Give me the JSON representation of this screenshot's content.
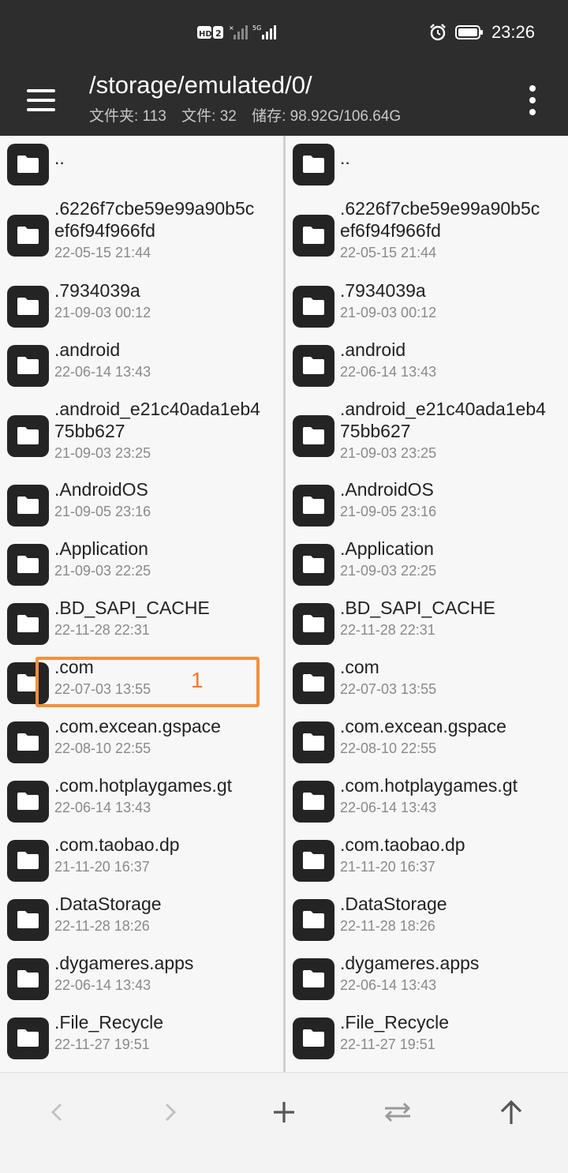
{
  "status_bar": {
    "network_badge": "HD 2",
    "network_5g": "5G",
    "time": "23:26",
    "icons": [
      "hd-icon",
      "signal-x-icon",
      "signal-5g-icon",
      "alarm-icon",
      "battery-icon"
    ]
  },
  "toolbar": {
    "path": "/storage/emulated/0/",
    "folders_label": "文件夹: 113",
    "files_label": "文件: 32",
    "storage_label": "储存: 98.92G/106.64G"
  },
  "annotation": {
    "label": "1"
  },
  "panes": {
    "left": {
      "items": [
        {
          "name": "..",
          "date": ""
        },
        {
          "name": ".6226f7cbe59e99a90b5c",
          "name2": "ef6f94f966fd",
          "date": "22-05-15 21:44"
        },
        {
          "name": ".7934039a",
          "date": "21-09-03 00:12"
        },
        {
          "name": ".android",
          "date": "22-06-14 13:43"
        },
        {
          "name": ".android_e21c40ada1eb4",
          "name2": "75bb627",
          "date": "21-09-03 23:25"
        },
        {
          "name": ".AndroidOS",
          "date": "21-09-05 23:16"
        },
        {
          "name": ".Application",
          "date": "21-09-03 22:25"
        },
        {
          "name": ".BD_SAPI_CACHE",
          "date": "22-11-28 22:31"
        },
        {
          "name": ".com",
          "date": "22-07-03 13:55"
        },
        {
          "name": ".com.excean.gspace",
          "date": "22-08-10 22:55"
        },
        {
          "name": ".com.hotplaygames.gt",
          "date": "22-06-14 13:43"
        },
        {
          "name": ".com.taobao.dp",
          "date": "21-11-20 16:37"
        },
        {
          "name": ".DataStorage",
          "date": "22-11-28 18:26"
        },
        {
          "name": ".dygameres.apps",
          "date": "22-06-14 13:43"
        },
        {
          "name": ".File_Recycle",
          "date": "22-11-27 19:51"
        }
      ]
    },
    "right": {
      "items": [
        {
          "name": "..",
          "date": ""
        },
        {
          "name": ".6226f7cbe59e99a90b5c",
          "name2": "ef6f94f966fd",
          "date": "22-05-15 21:44"
        },
        {
          "name": ".7934039a",
          "date": "21-09-03 00:12"
        },
        {
          "name": ".android",
          "date": "22-06-14 13:43"
        },
        {
          "name": ".android_e21c40ada1eb4",
          "name2": "75bb627",
          "date": "21-09-03 23:25"
        },
        {
          "name": ".AndroidOS",
          "date": "21-09-05 23:16"
        },
        {
          "name": ".Application",
          "date": "21-09-03 22:25"
        },
        {
          "name": ".BD_SAPI_CACHE",
          "date": "22-11-28 22:31"
        },
        {
          "name": ".com",
          "date": "22-07-03 13:55"
        },
        {
          "name": ".com.excean.gspace",
          "date": "22-08-10 22:55"
        },
        {
          "name": ".com.hotplaygames.gt",
          "date": "22-06-14 13:43"
        },
        {
          "name": ".com.taobao.dp",
          "date": "21-11-20 16:37"
        },
        {
          "name": ".DataStorage",
          "date": "22-11-28 18:26"
        },
        {
          "name": ".dygameres.apps",
          "date": "22-06-14 13:43"
        },
        {
          "name": ".File_Recycle",
          "date": "22-11-27 19:51"
        }
      ]
    }
  },
  "bottom_bar": {
    "buttons": [
      "back-icon",
      "forward-icon",
      "add-icon",
      "swap-panes-icon",
      "up-directory-icon"
    ]
  },
  "colors": {
    "header_bg": "#2d2d2d",
    "highlight": "#f58f3c",
    "folder_icon_bg": "#242424"
  }
}
